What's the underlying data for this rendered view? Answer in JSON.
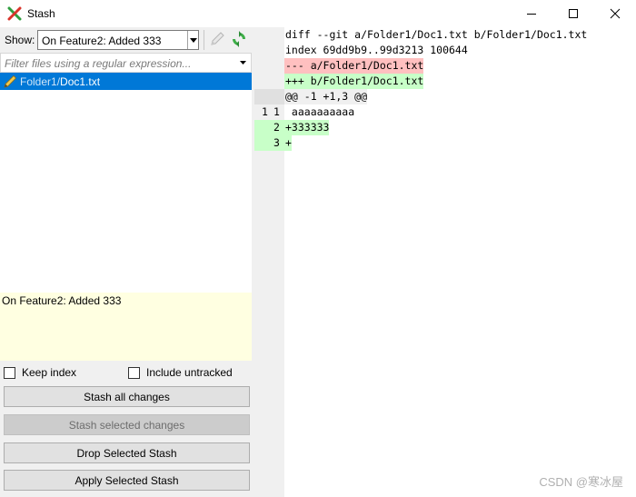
{
  "window": {
    "title": "Stash",
    "app_icon": "git-extensions-icon",
    "controls": [
      "minimize-icon",
      "maximize-icon",
      "close-icon"
    ]
  },
  "left": {
    "show_label": "Show:",
    "show_value": "On Feature2: Added 333",
    "filter_placeholder": "Filter files using a regular expression...",
    "file": {
      "folder": "Folder1/",
      "name": "Doc1.txt",
      "icon": "pencil-modified-icon"
    },
    "message": "On Feature2: Added 333",
    "keep_index_label": "Keep index",
    "keep_index_checked": false,
    "include_untracked_label": "Include untracked",
    "include_untracked_checked": false,
    "buttons": {
      "stash_all": "Stash all changes",
      "stash_selected": "Stash selected changes",
      "drop": "Drop Selected Stash",
      "apply": "Apply Selected Stash"
    }
  },
  "diff": {
    "header_lines": [
      "diff --git a/Folder1/Doc1.txt b/Folder1/Doc1.txt",
      "index 69dd9b9..99d3213 100644"
    ],
    "minus_file": "--- a/Folder1/Doc1.txt",
    "plus_file": "+++ b/Folder1/Doc1.txt",
    "hunk": "@@ -1 +1,3 @@",
    "lines": [
      {
        "old": "1",
        "new": "1",
        "text": " aaaaaaaaaa",
        "type": "context"
      },
      {
        "old": "",
        "new": "2",
        "text": "+333333",
        "type": "added"
      },
      {
        "old": "",
        "new": "3",
        "text": "+",
        "type": "added"
      }
    ]
  },
  "watermark": "CSDN @寒冰屋",
  "colors": {
    "selection": "#0078d7",
    "removed_bg": "#ffc0c0",
    "added_bg": "#c8ffc8",
    "message_bg": "#ffffe1"
  }
}
